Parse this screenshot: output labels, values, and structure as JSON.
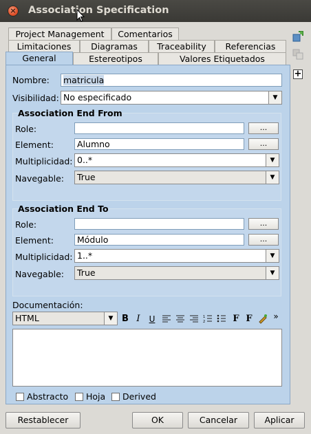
{
  "window": {
    "title": "Association Specification"
  },
  "tabs_row1": [
    "Project Management",
    "Comentarios"
  ],
  "tabs_row2": [
    "Limitaciones",
    "Diagramas",
    "Traceability",
    "Referencias"
  ],
  "tabs_row3": [
    "General",
    "Estereotipos",
    "Valores Etiquetados"
  ],
  "form": {
    "nombre_label": "Nombre:",
    "nombre_value": "matricula",
    "visibilidad_label": "Visibilidad:",
    "visibilidad_value": "No especificado"
  },
  "end_from": {
    "title": "Association End From",
    "role_label": "Role:",
    "role_value": "",
    "element_label": "Element:",
    "element_value": "Alumno",
    "mult_label": "Multiplicidad:",
    "mult_value": "0..*",
    "nav_label": "Navegable:",
    "nav_value": "True",
    "browse": "..."
  },
  "end_to": {
    "title": "Association End To",
    "role_label": "Role:",
    "role_value": "",
    "element_label": "Element:",
    "element_value": "Módulo",
    "mult_label": "Multiplicidad:",
    "mult_value": "1..*",
    "nav_label": "Navegable:",
    "nav_value": "True",
    "browse": "..."
  },
  "doc": {
    "label": "Documentación:",
    "format": "HTML",
    "tools": [
      "B",
      "I",
      "U",
      "align-left",
      "align-center",
      "align-right",
      "numbered-list",
      "bullet-list",
      "F",
      "F",
      "color",
      "»"
    ],
    "content": ""
  },
  "checkboxes": [
    "Abstracto",
    "Hoja",
    "Derived"
  ],
  "buttons": {
    "reset": "Restablecer",
    "ok": "OK",
    "cancel": "Cancelar",
    "apply": "Aplicar"
  }
}
